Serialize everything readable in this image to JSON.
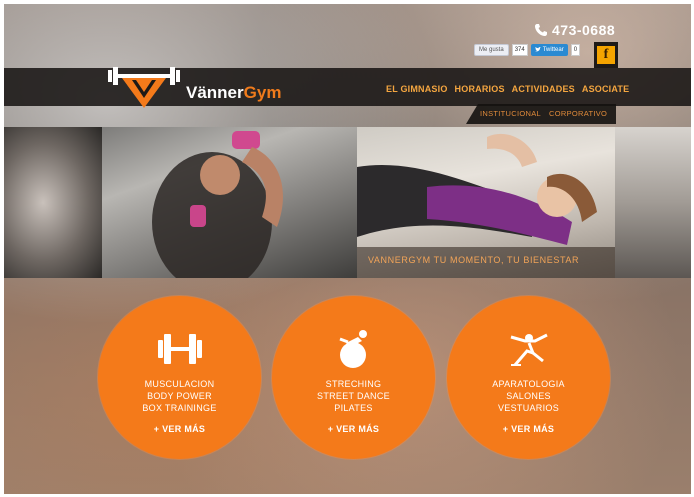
{
  "header": {
    "phone": "473-0688",
    "brand_part1": "Vänner",
    "brand_part2": "Gym",
    "social": {
      "like_label": "Me gusta",
      "like_count": "374",
      "tweet_label": "Twittear",
      "tweet_count": "0",
      "facebook_glyph": "f"
    }
  },
  "nav": {
    "items": [
      "EL GIMNASIO",
      "HORARIOS",
      "ACTIVIDADES",
      "ASOCIATE"
    ],
    "subitems": [
      "INSTITUCIONAL",
      "CORPORATIVO"
    ]
  },
  "hero": {
    "tagline": "VANNERGYM TU MOMENTO, TU BIENESTAR"
  },
  "features": [
    {
      "icon": "dumbbell-icon",
      "lines": [
        "MUSCULACION",
        "BODY POWER",
        "BOX TRAININGE"
      ],
      "more": "+ VER MÁS"
    },
    {
      "icon": "fitness-ball-icon",
      "lines": [
        "STRECHING",
        "STREET DANCE",
        "PILATES"
      ],
      "more": "+ VER MÁS"
    },
    {
      "icon": "exercise-machine-icon",
      "lines": [
        "APARATOLOGIA",
        "SALONES",
        "VESTUARIOS"
      ],
      "more": "+ VER MÁS"
    }
  ],
  "colors": {
    "accent": "#f47a1a",
    "nav_text": "#f5a640",
    "header_bar": "#191614"
  }
}
